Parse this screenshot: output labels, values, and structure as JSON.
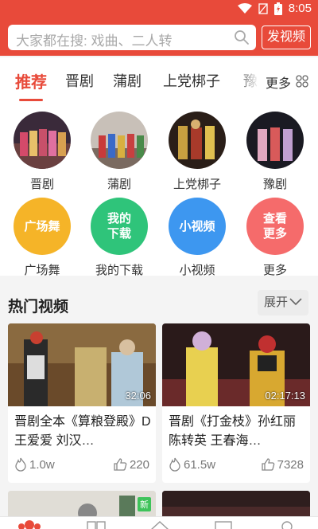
{
  "status_bar": {
    "time": "8:05"
  },
  "search": {
    "placeholder": "大家都在搜: 戏曲、二人转",
    "publish_label": "发视频"
  },
  "tabs": [
    {
      "label": "推荐",
      "active": true
    },
    {
      "label": "晋剧"
    },
    {
      "label": "蒲剧"
    },
    {
      "label": "上党梆子"
    },
    {
      "label": "豫剧"
    }
  ],
  "more_tab": {
    "label": "更多"
  },
  "categories": [
    {
      "label": "晋剧",
      "type": "photo"
    },
    {
      "label": "蒲剧",
      "type": "photo"
    },
    {
      "label": "上党梆子",
      "type": "photo"
    },
    {
      "label": "豫剧",
      "type": "photo"
    },
    {
      "label": "广场舞",
      "circle_text": "广场舞",
      "color": "#f5b428"
    },
    {
      "label": "我的下载",
      "circle_text": "我的\n下载",
      "color": "#2fc47a"
    },
    {
      "label": "小视频",
      "circle_text": "小视频",
      "color": "#3d97f0"
    },
    {
      "label": "更多",
      "circle_text": "查看\n更多",
      "color": "#f56b6b"
    }
  ],
  "hot_videos": {
    "title": "热门视频",
    "expand_label": "展开",
    "items": [
      {
        "title": "晋剧全本《算粮登殿》D 王爱爱 刘汉…",
        "duration": "32:06",
        "plays": "1.0w",
        "likes": "220"
      },
      {
        "title": "晋剧《打金枝》孙红丽 陈转英 王春海…",
        "duration": "02:17:13",
        "plays": "61.5w",
        "likes": "7328"
      }
    ],
    "partial_badge": "新"
  },
  "colors": {
    "brand": "#e84a3a"
  }
}
